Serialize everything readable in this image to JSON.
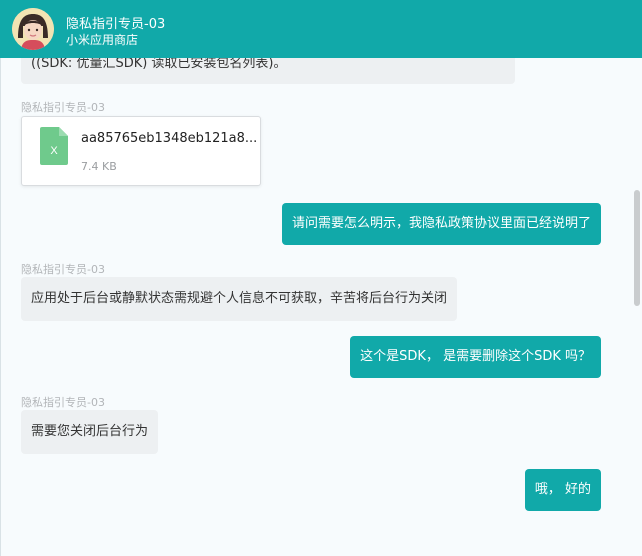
{
  "header": {
    "title": "隐私指引专员-03",
    "subtitle": "小米应用商店"
  },
  "messages": {
    "m0_text": "((SDK: 优量汇SDK) 读取已安装包名列表)。",
    "file_sender": "隐私指引专员-03",
    "file_name": "aa85765eb1348eb121a8...",
    "file_size": "7.4 KB",
    "file_icon_letter": "X",
    "m1_text": "请问需要怎么明示，我隐私政策协议里面已经说明了",
    "m2_sender": "隐私指引专员-03",
    "m2_text": "应用处于后台或静默状态需规避个人信息不可获取，辛苦将后台行为关闭",
    "m3_text": "这个是SDK， 是需要删除这个SDK 吗？",
    "m4_sender": "隐私指引专员-03",
    "m4_text": "需要您关闭后台行为",
    "m5_text": "哦， 好的"
  },
  "colors": {
    "accent": "#11a9a9",
    "left_bubble": "#edf0f2",
    "file_icon": "#6fca8c"
  },
  "icons": {
    "avatar": "female-avatar",
    "file": "excel-file-icon"
  }
}
